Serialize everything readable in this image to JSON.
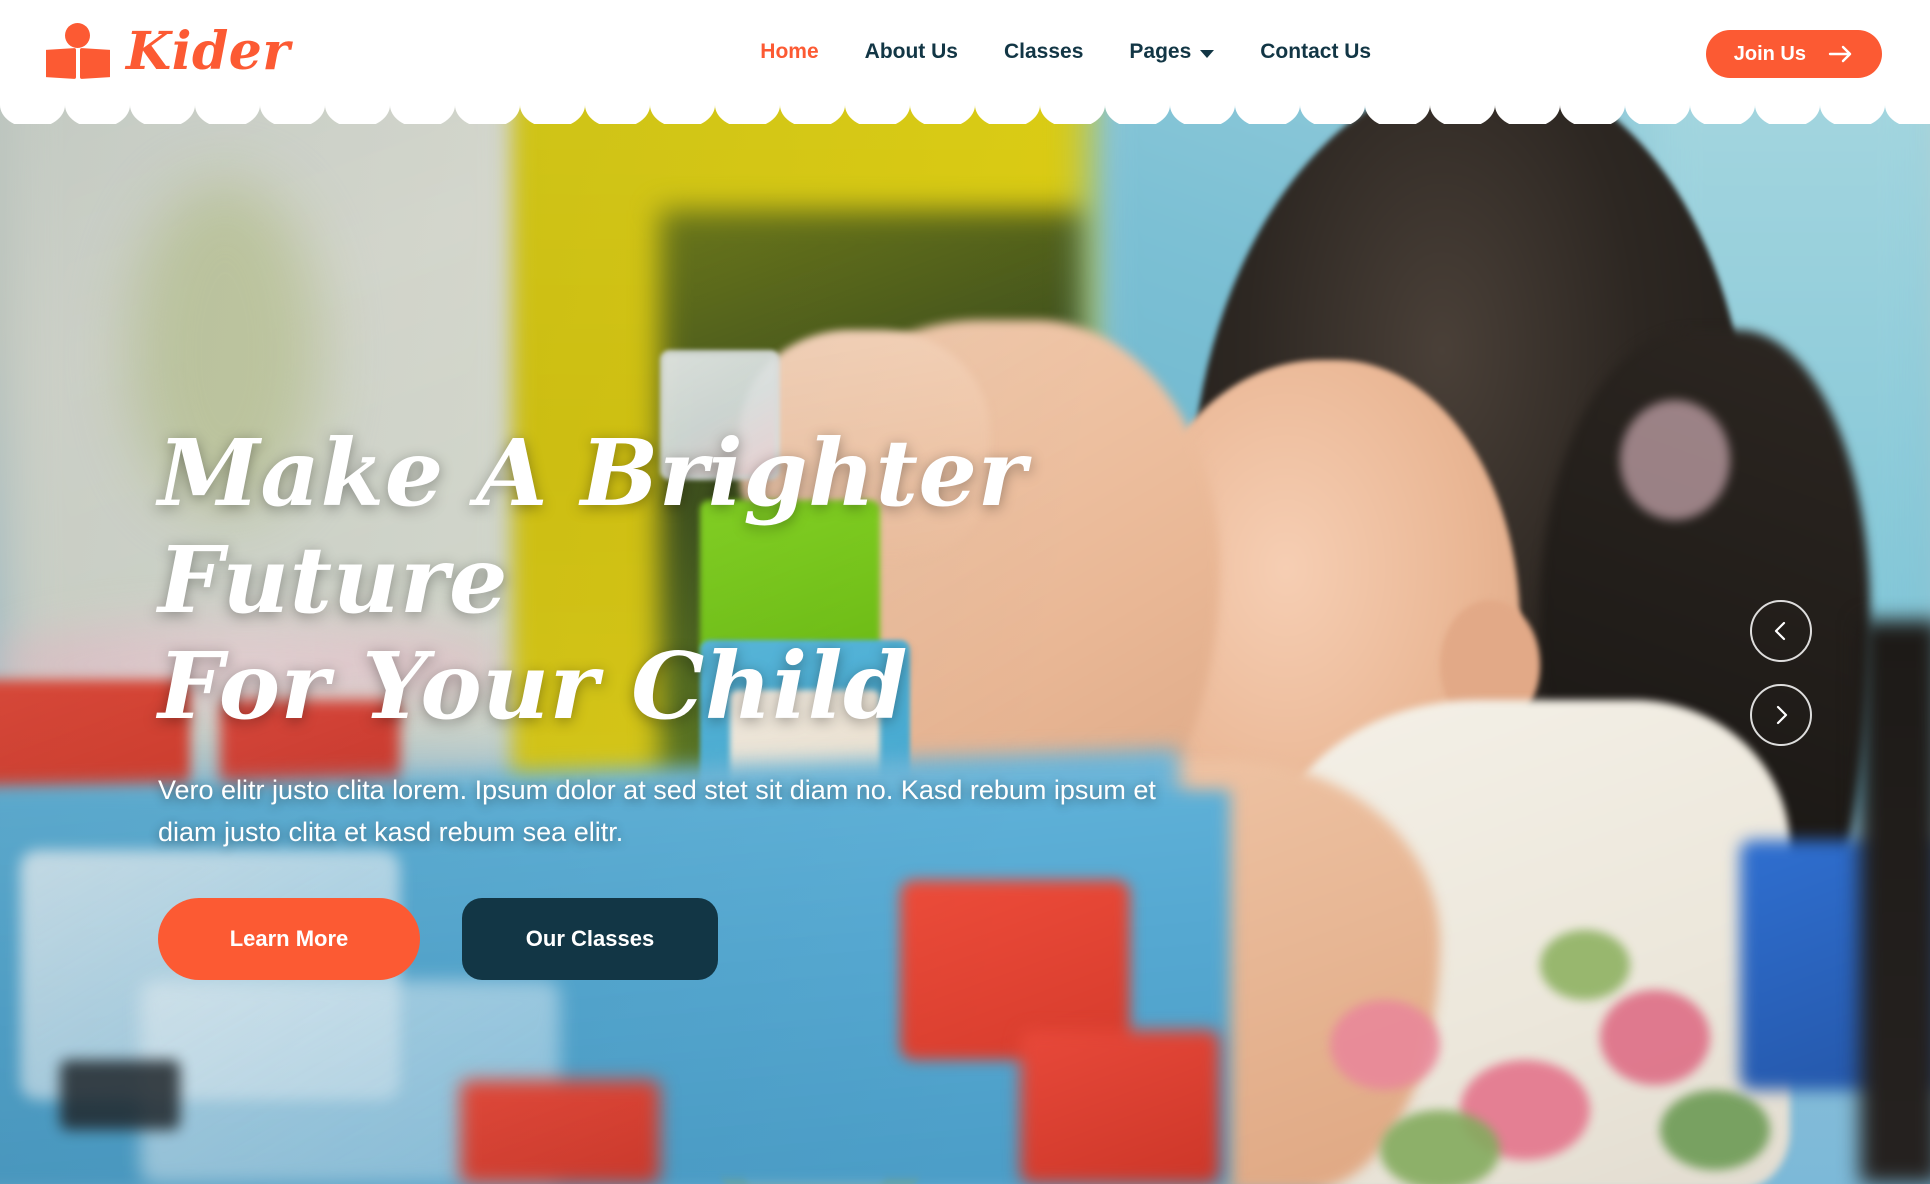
{
  "header": {
    "brand": {
      "name": "Kider",
      "icon": "book-reader-icon",
      "color": "#fc5a33"
    },
    "nav": [
      {
        "label": "Home",
        "active": true
      },
      {
        "label": "About Us",
        "active": false
      },
      {
        "label": "Classes",
        "active": false
      },
      {
        "label": "Pages",
        "active": false,
        "has_dropdown": true
      },
      {
        "label": "Contact Us",
        "active": false
      }
    ],
    "cta": {
      "label": "Join Us",
      "icon": "arrow-right-icon"
    }
  },
  "hero": {
    "title_line1": "Make A Brighter Future",
    "title_line2": "For Your Child",
    "paragraph": "Vero elitr justo clita lorem. Ipsum dolor at sed stet sit diam no. Kasd rebum ipsum et diam justo clita et kasd rebum sea elitr.",
    "primary_button": "Learn More",
    "secondary_button": "Our Classes",
    "carousel": {
      "prev": "chevron-left-icon",
      "next": "chevron-right-icon"
    }
  },
  "colors": {
    "accent": "#fc5a33",
    "dark": "#123645",
    "white": "#ffffff"
  }
}
